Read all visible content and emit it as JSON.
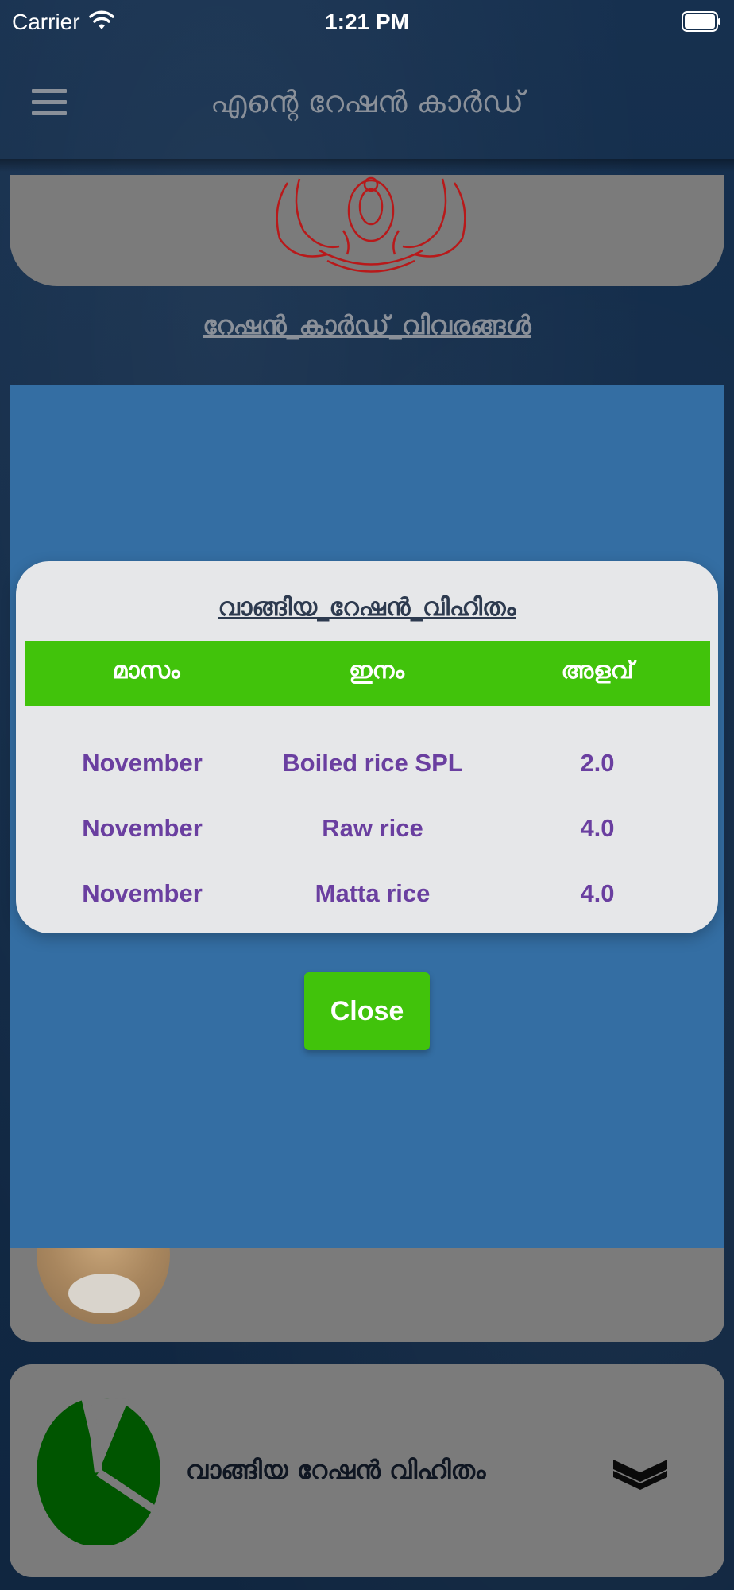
{
  "status_bar": {
    "carrier": "Carrier",
    "time": "1:21 PM"
  },
  "header": {
    "title": "എന്റെ റേഷൻ കാർഡ്"
  },
  "details_link": "റേഷൻ_കാർഡ്_വിവരങ്ങൾ",
  "dialog": {
    "title": "വാങ്ങിയ_റേഷൻ_വിഹിതം",
    "columns": [
      "മാസം",
      "ഇനം",
      "അളവ്"
    ],
    "rows": [
      [
        "November",
        "Boiled rice SPL",
        "2.0"
      ],
      [
        "November",
        "Raw rice",
        "4.0"
      ],
      [
        "November",
        "Matta rice",
        "4.0"
      ]
    ],
    "close_label": "Close"
  },
  "cards": {
    "purchase_label": "വാങ്ങിയ റേഷൻ വിഹിതം"
  },
  "colors": {
    "accent_green": "#41c30b",
    "overlay_blue": "#346ea3",
    "row_text": "#6a3fa0",
    "card_gray": "#7b7b7b"
  }
}
